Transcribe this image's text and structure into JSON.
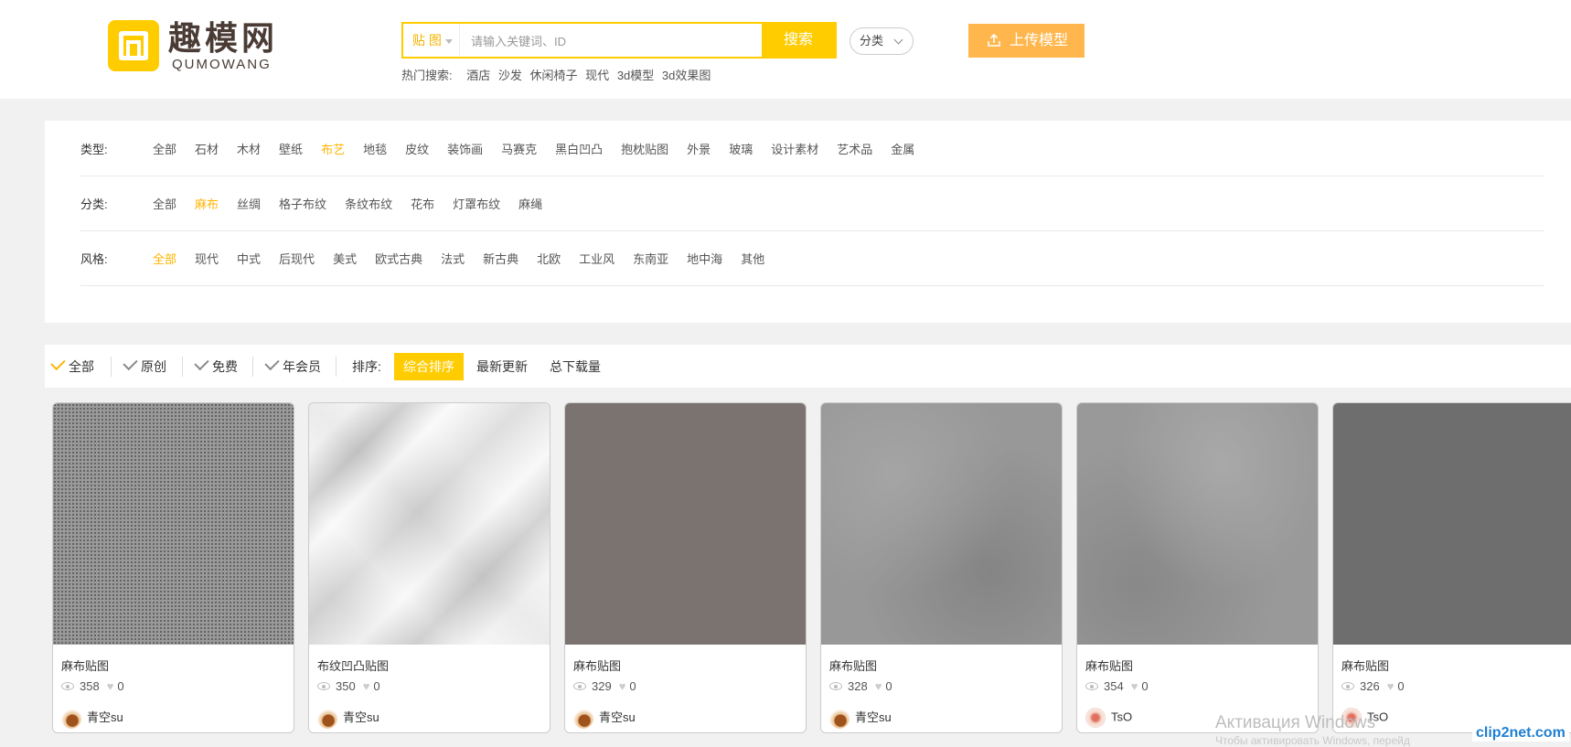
{
  "brand": {
    "name": "趣模网",
    "sub": "QUMOWANG"
  },
  "search": {
    "type_label": "贴 图",
    "placeholder": "请输入关键词、ID",
    "button": "搜索",
    "hot_label": "热门搜索:",
    "hot_terms": [
      "酒店",
      "沙发",
      "休闲椅子",
      "现代",
      "3d模型",
      "3d效果图"
    ]
  },
  "category_button": "分类",
  "upload_button": "上传模型",
  "filters": {
    "type": {
      "label": "类型:",
      "items": [
        "全部",
        "石材",
        "木材",
        "壁纸",
        "布艺",
        "地毯",
        "皮纹",
        "装饰画",
        "马赛克",
        "黑白凹凸",
        "抱枕贴图",
        "外景",
        "玻璃",
        "设计素材",
        "艺术品",
        "金属"
      ],
      "active": "布艺"
    },
    "category": {
      "label": "分类:",
      "items": [
        "全部",
        "麻布",
        "丝绸",
        "格子布纹",
        "条纹布纹",
        "花布",
        "灯罩布纹",
        "麻绳"
      ],
      "active": "麻布"
    },
    "style": {
      "label": "风格:",
      "items": [
        "全部",
        "现代",
        "中式",
        "后现代",
        "美式",
        "欧式古典",
        "法式",
        "新古典",
        "北欧",
        "工业风",
        "东南亚",
        "地中海",
        "其他"
      ],
      "active": "全部"
    }
  },
  "sortbar": {
    "checks": [
      {
        "label": "全部",
        "active": true
      },
      {
        "label": "原创",
        "active": false
      },
      {
        "label": "免费",
        "active": false
      },
      {
        "label": "年会员",
        "active": false
      }
    ],
    "sort_label": "排序:",
    "sort_options": [
      {
        "label": "综合排序",
        "active": true
      },
      {
        "label": "最新更新",
        "active": false
      },
      {
        "label": "总下载量",
        "active": false
      }
    ]
  },
  "cards": [
    {
      "title": "麻布贴图",
      "views": "358",
      "likes": "0",
      "author": "青空su"
    },
    {
      "title": "布纹凹凸贴图",
      "views": "350",
      "likes": "0",
      "author": "青空su"
    },
    {
      "title": "麻布贴图",
      "views": "329",
      "likes": "0",
      "author": "青空su"
    },
    {
      "title": "麻布贴图",
      "views": "328",
      "likes": "0",
      "author": "青空su"
    },
    {
      "title": "麻布贴图",
      "views": "354",
      "likes": "0",
      "author": "TsO"
    },
    {
      "title": "麻布贴图",
      "views": "326",
      "likes": "0",
      "author": "TsO"
    }
  ],
  "watermark": {
    "windows": "Активация Windows",
    "windows_sub": "Чтобы активировать Windows, перейд",
    "clip2net": "clip2net.com"
  },
  "colors": {
    "accent": "#ffcc00",
    "active_text": "#ffb400",
    "upload": "#ffb74d"
  }
}
